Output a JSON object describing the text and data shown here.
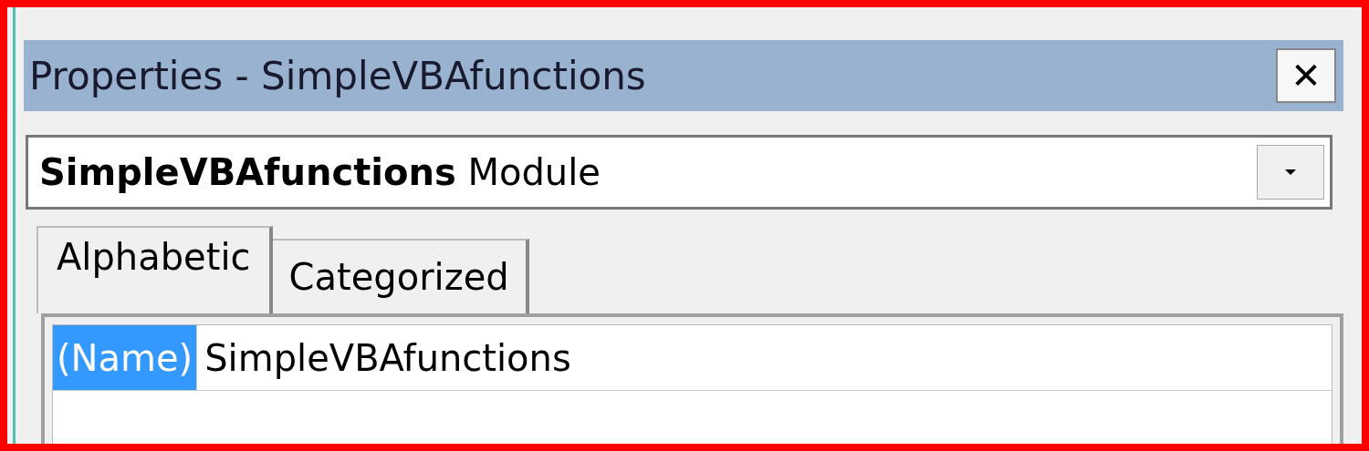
{
  "window": {
    "title": "Properties - SimpleVBAfunctions",
    "close": "✕"
  },
  "object_selector": {
    "name": "SimpleVBAfunctions",
    "type": "Module"
  },
  "tabs": [
    {
      "label": "Alphabetic",
      "selected": true
    },
    {
      "label": "Categorized",
      "selected": false
    }
  ],
  "properties": [
    {
      "name": "(Name)",
      "value": "SimpleVBAfunctions",
      "selected": true
    }
  ]
}
